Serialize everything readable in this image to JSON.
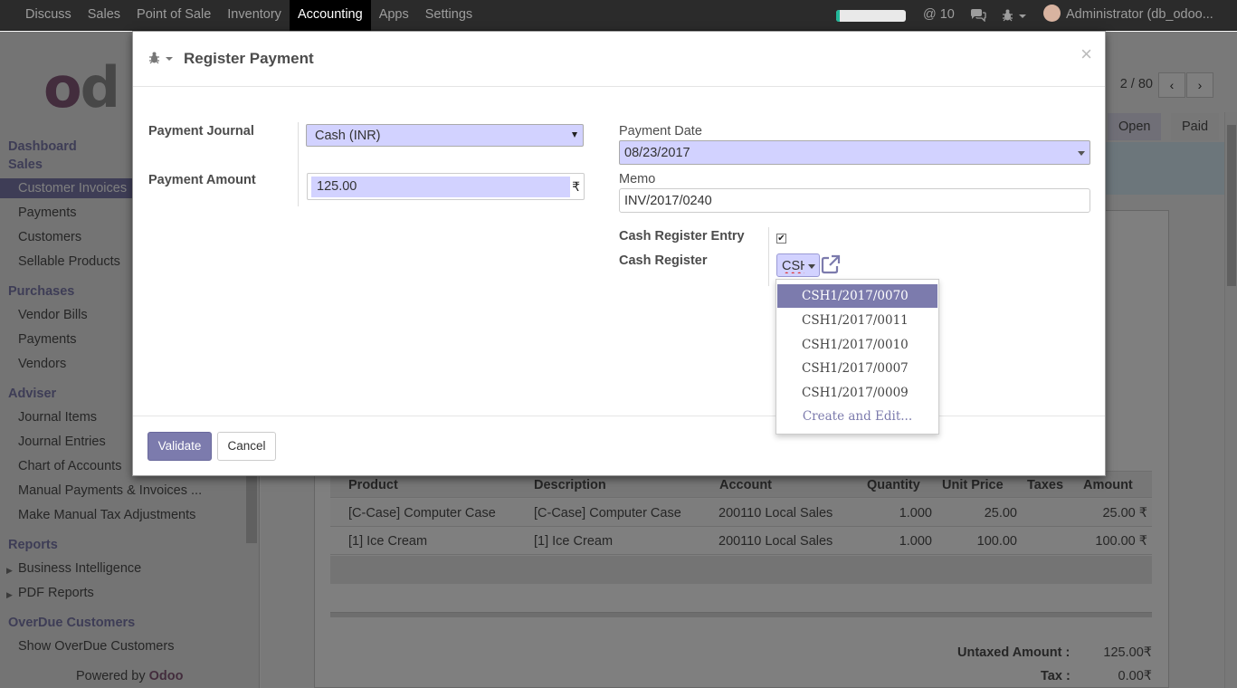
{
  "topbar": {
    "menu": [
      "Discuss",
      "Sales",
      "Point of Sale",
      "Inventory",
      "Accounting",
      "Apps",
      "Settings"
    ],
    "active_menu": "Accounting",
    "progress_fraction": 0.05,
    "messages_count": "@ 10",
    "user": "Administrator (db_odoo..."
  },
  "sidebar": {
    "sections": [
      {
        "title": "Dashboard"
      },
      {
        "title": "Sales",
        "items": [
          "Customer Invoices",
          "Payments",
          "Customers",
          "Sellable Products"
        ]
      },
      {
        "title": "Purchases",
        "items": [
          "Vendor Bills",
          "Payments",
          "Vendors"
        ]
      },
      {
        "title": "Adviser",
        "items": [
          "Journal Items",
          "Journal Entries",
          "Chart of Accounts",
          "Manual Payments & Invoices ...",
          "Make Manual Tax Adjustments"
        ]
      },
      {
        "title": "Reports",
        "items": [
          "Business Intelligence",
          "PDF Reports"
        ]
      },
      {
        "title": "OverDue Customers",
        "items": [
          "Show OverDue Customers"
        ]
      }
    ],
    "powered_by": "Powered by",
    "powered_brand": "Odoo"
  },
  "background": {
    "pager": "2 / 80",
    "stages": [
      "Open",
      "Paid"
    ],
    "lines_headers": [
      "Product",
      "Description",
      "Account",
      "Quantity",
      "Unit Price",
      "Taxes",
      "Amount"
    ],
    "lines": [
      [
        "[C-Case] Computer Case",
        "[C-Case] Computer Case",
        "200110 Local Sales",
        "1.000",
        "25.00",
        "",
        "25.00 ₹"
      ],
      [
        "[1] Ice Cream",
        "[1] Ice Cream",
        "200110 Local Sales",
        "1.000",
        "100.00",
        "",
        "100.00 ₹"
      ]
    ],
    "untaxed_label": "Untaxed Amount :",
    "untaxed_value": "125.00₹",
    "tax_label": "Tax :",
    "tax_value": "0.00₹"
  },
  "modal": {
    "title": "Register Payment",
    "close": "×",
    "payment_journal_label": "Payment Journal",
    "payment_journal_value": "Cash (INR)",
    "payment_amount_label": "Payment Amount",
    "payment_amount_value": "125.00",
    "currency_symbol": "₹",
    "payment_date_label": "Payment Date",
    "payment_date_value": "08/23/2017",
    "memo_label": "Memo",
    "memo_value": "INV/2017/0240",
    "cash_register_entry_label": "Cash Register Entry",
    "cash_register_entry_checked": "✔",
    "cash_register_label": "Cash Register",
    "cash_register_value": "CSH",
    "validate_label": "Validate",
    "cancel_label": "Cancel"
  },
  "dropdown": {
    "options": [
      "CSH1/2017/0070",
      "CSH1/2017/0011",
      "CSH1/2017/0010",
      "CSH1/2017/0007",
      "CSH1/2017/0009"
    ],
    "create_label": "Create and Edit..."
  },
  "colors": {
    "accent": "#7c7bad",
    "brand": "#875a7b",
    "field_highlight": "#d2d2ff"
  }
}
